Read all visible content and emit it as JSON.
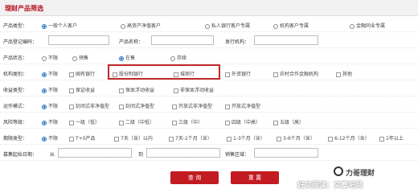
{
  "page_title": "理财产品筛选",
  "rows": {
    "customer": {
      "label": "产品类型：",
      "options": [
        "一般个人客户",
        "高资产净值客户",
        "私人银行客户专属",
        "机构客户专属",
        "金融同业专属"
      ],
      "selected": 0
    },
    "registration": {
      "code_label": "产品登记编码：",
      "name_label": "产品名称：",
      "issuer_label": "发行机构："
    },
    "status": {
      "label": "产品状态：",
      "options": [
        "不限",
        "预售",
        "在售",
        "存续"
      ],
      "selected": 2
    },
    "institution": {
      "label": "机构类别：",
      "options": [
        "不限",
        "国有银行",
        "股份制银行",
        "城商行",
        "外资银行",
        "农村合作金融机构",
        "其他"
      ],
      "selected": 0
    },
    "yield": {
      "label": "收益类型：",
      "options": [
        "不限",
        "保证收益",
        "保本浮动收益",
        "非保本浮动收益"
      ],
      "selected": 0
    },
    "operation": {
      "label": "运作模式：",
      "options": [
        "不限",
        "封闭式非净值型",
        "封闭式净值型",
        "开放式非净值型",
        "开放式净值型"
      ],
      "selected": 0
    },
    "risk": {
      "label": "风险等级：",
      "options": [
        "不限",
        "一级（低）",
        "二级（中低）",
        "三级（中）",
        "四级（中高）",
        "五级（高）"
      ],
      "selected": 0
    },
    "term": {
      "label": "期限类型：",
      "options": [
        "不限",
        "T+0产品",
        "7天（含）以内",
        "7天-1个月（含）",
        "1-3个月（含）",
        "3-6个月（含）",
        "6-12个月（含）",
        "1年以上"
      ],
      "selected": 0
    },
    "date": {
      "label": "募集起始日期：",
      "from": "从",
      "to": "到",
      "region_label": "销售区域："
    }
  },
  "buttons": {
    "query": "查 询",
    "reset": "重 置"
  },
  "watermark": {
    "brand": "力哥理财",
    "site": "好文阅读：文章吧网"
  }
}
